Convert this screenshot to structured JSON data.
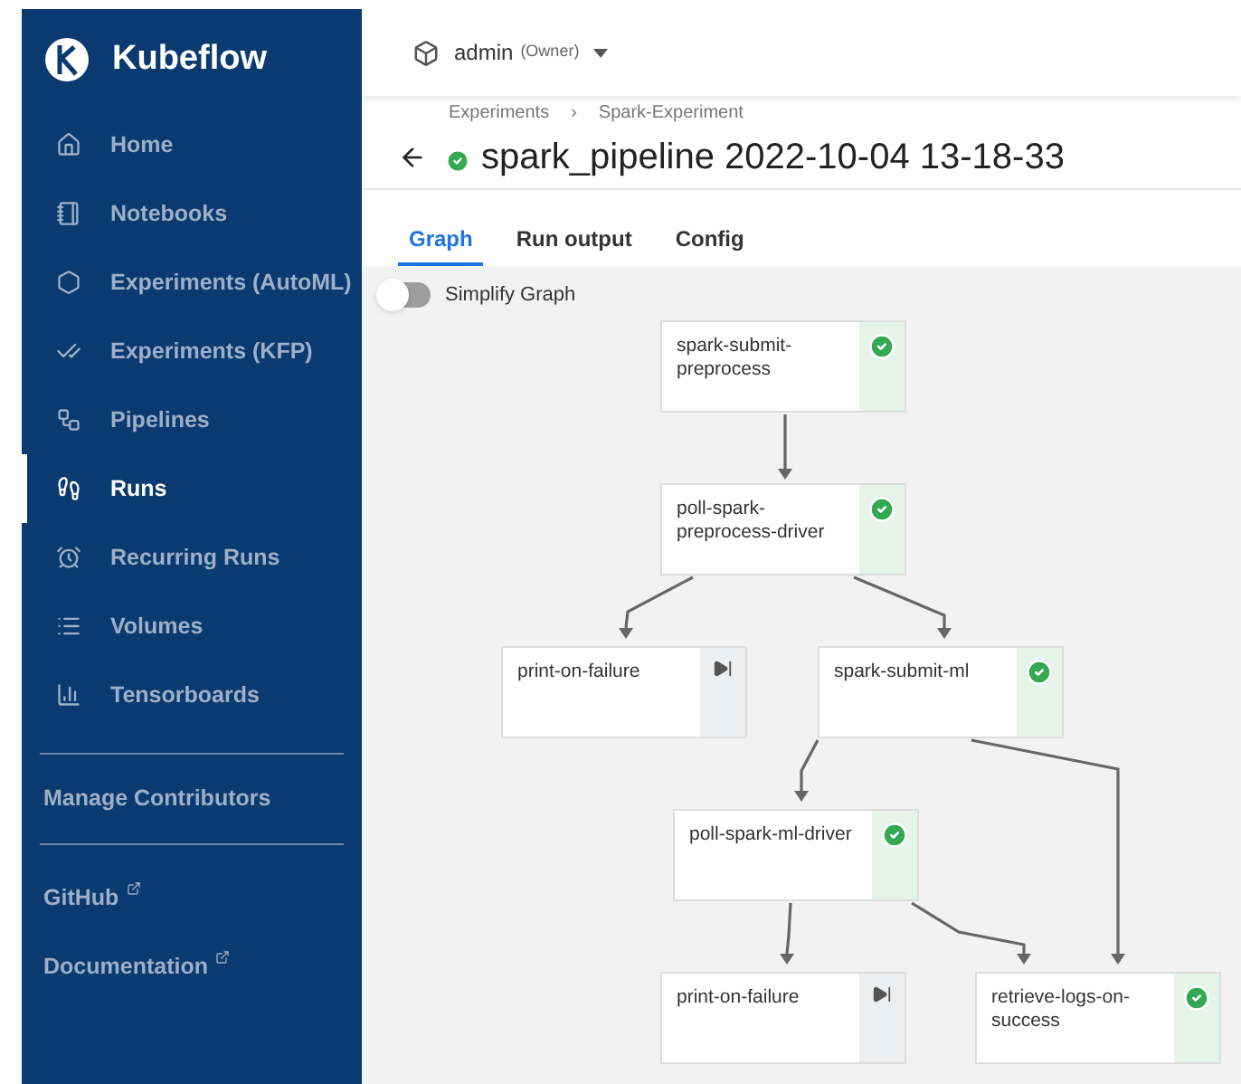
{
  "sidebar": {
    "logo": "Kubeflow",
    "items": [
      {
        "label": "Home",
        "selected": false
      },
      {
        "label": "Notebooks",
        "selected": false
      },
      {
        "label": "Experiments (AutoML)",
        "selected": false
      },
      {
        "label": "Experiments (KFP)",
        "selected": false
      },
      {
        "label": "Pipelines",
        "selected": false
      },
      {
        "label": "Runs",
        "selected": true
      },
      {
        "label": "Recurring Runs",
        "selected": false
      },
      {
        "label": "Volumes",
        "selected": false
      },
      {
        "label": "Tensorboards",
        "selected": false
      }
    ],
    "manage": "Manage Contributors",
    "links": [
      "GitHub",
      "Documentation"
    ]
  },
  "header": {
    "namespace": "admin",
    "role": "(Owner)"
  },
  "breadcrumbs": [
    "Experiments",
    "Spark-Experiment"
  ],
  "breadcrumb_separator": "›",
  "title": "spark_pipeline 2022-10-04 13-18-33",
  "tabs": [
    {
      "label": "Graph",
      "selected": true
    },
    {
      "label": "Run output",
      "selected": false
    },
    {
      "label": "Config",
      "selected": false
    }
  ],
  "simplify": {
    "label": "Simplify Graph",
    "on": false
  },
  "nodes": [
    {
      "label": "spark-submit-preprocess",
      "kind": "succeeded"
    },
    {
      "label": "poll-spark-preprocess-driver",
      "kind": "succeeded"
    },
    {
      "label": "print-on-failure",
      "kind": "skipped"
    },
    {
      "label": "spark-submit-ml",
      "kind": "succeeded"
    },
    {
      "label": "poll-spark-ml-driver",
      "kind": "succeeded"
    },
    {
      "label": "print-on-failure",
      "kind": "skipped"
    },
    {
      "label": "retrieve-logs-on-success",
      "kind": "succeeded"
    }
  ]
}
